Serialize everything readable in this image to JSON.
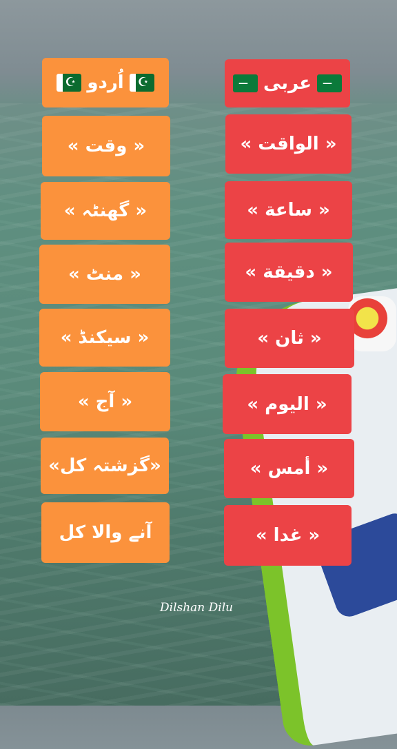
{
  "headers": {
    "urdu": "اُردو",
    "arabic": "عربی"
  },
  "urdu_words": [
    "« وقت »",
    "« گھنٹہ »",
    "« منٹ »",
    "« سیکنڈ »",
    "« آج »",
    "«گزشتہ کل»",
    "آنے والا کل"
  ],
  "arabic_words": [
    "« الواقت »",
    "« ساعة »",
    "« دقیقة »",
    "« ثان »",
    "« الیوم »",
    "« أمس »",
    "« غدا »"
  ],
  "watermark": "Dilshan Dilu",
  "flags": {
    "urdu": "pakistan-flag",
    "arabic": "saudi-flag"
  },
  "colors": {
    "urdu_card": "#fb923c",
    "arabic_card": "#ec4346"
  }
}
